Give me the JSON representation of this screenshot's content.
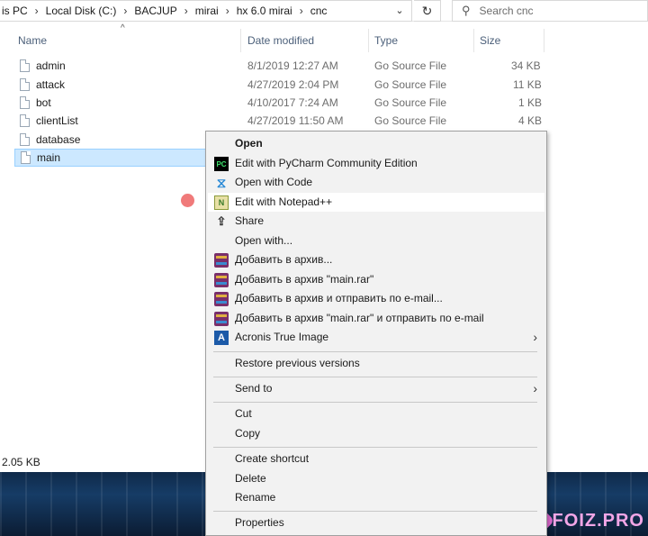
{
  "address": {
    "crumbs": [
      "is PC",
      "Local Disk (C:)",
      "BACJUP",
      "mirai",
      "hx 6.0 mirai",
      "cnc"
    ],
    "search_placeholder": "Search cnc"
  },
  "columns": {
    "name": "Name",
    "date": "Date modified",
    "type": "Type",
    "size": "Size"
  },
  "files": [
    {
      "name": "admin",
      "date": "8/1/2019 12:27 AM",
      "type": "Go Source File",
      "size": "34 KB"
    },
    {
      "name": "attack",
      "date": "4/27/2019 2:04 PM",
      "type": "Go Source File",
      "size": "11 KB"
    },
    {
      "name": "bot",
      "date": "4/10/2017 7:24 AM",
      "type": "Go Source File",
      "size": "1 KB"
    },
    {
      "name": "clientList",
      "date": "4/27/2019 11:50 AM",
      "type": "Go Source File",
      "size": "4 KB"
    },
    {
      "name": "database",
      "date": "",
      "type": "",
      "size": ""
    },
    {
      "name": "main",
      "date": "",
      "type": "",
      "size": ""
    }
  ],
  "status": "2.05 KB",
  "menu": {
    "items": [
      {
        "label": "Open",
        "icon": "none",
        "bold": true
      },
      {
        "label": "Edit with PyCharm Community Edition",
        "icon": "pycharm-icon",
        "icon_text": "PC"
      },
      {
        "label": "Open with Code",
        "icon": "vscode-icon",
        "icon_text": "⧖"
      },
      {
        "label": "Edit with Notepad++",
        "icon": "notepadpp-icon",
        "icon_text": "N"
      },
      {
        "label": "Share",
        "icon": "share-icon",
        "icon_text": "⇪"
      },
      {
        "label": "Open with...",
        "icon": "none"
      },
      {
        "label": "Добавить в архив...",
        "icon": "winrar-icon"
      },
      {
        "label": "Добавить в архив \"main.rar\"",
        "icon": "winrar-icon"
      },
      {
        "label": "Добавить в архив и отправить по e-mail...",
        "icon": "winrar-icon"
      },
      {
        "label": "Добавить в архив \"main.rar\" и отправить по e-mail",
        "icon": "winrar-icon"
      },
      {
        "label": "Acronis True Image",
        "icon": "acronis-icon",
        "icon_text": "A",
        "submenu": true
      },
      {
        "label": "Restore previous versions",
        "icon": "none"
      },
      {
        "label": "Send to",
        "icon": "none",
        "submenu": true
      },
      {
        "label": "Cut",
        "icon": "none"
      },
      {
        "label": "Copy",
        "icon": "none"
      },
      {
        "label": "Create shortcut",
        "icon": "none"
      },
      {
        "label": "Delete",
        "icon": "none"
      },
      {
        "label": "Rename",
        "icon": "none"
      },
      {
        "label": "Properties",
        "icon": "none"
      }
    ],
    "submenu_glyph": "›"
  },
  "watermark": {
    "text": "FOIZ.PRO"
  },
  "colors": {
    "selection": "#cce8ff",
    "selection_border": "#99d1ff",
    "header_text": "#4c607a",
    "menu_bg": "#f2f2f2"
  }
}
